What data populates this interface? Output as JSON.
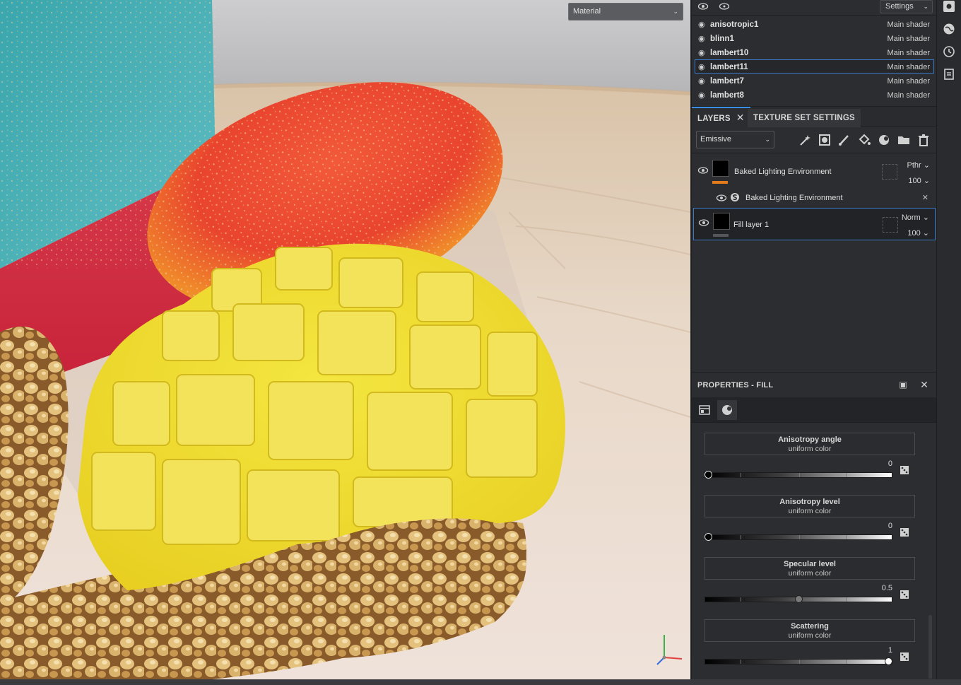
{
  "viewport": {
    "mode_select": "Material"
  },
  "texture_sets": {
    "settings_label": "Settings",
    "rows": [
      {
        "name": "anisotropic1",
        "shader": "Main shader"
      },
      {
        "name": "blinn1",
        "shader": "Main shader"
      },
      {
        "name": "lambert10",
        "shader": "Main shader"
      },
      {
        "name": "lambert11",
        "shader": "Main shader"
      },
      {
        "name": "lambert7",
        "shader": "Main shader"
      },
      {
        "name": "lambert8",
        "shader": "Main shader"
      }
    ],
    "selected": "lambert11"
  },
  "tabs": {
    "layers": "LAYERS",
    "texture_set_settings": "TEXTURE SET SETTINGS"
  },
  "layers_panel": {
    "channel": "Emissive",
    "layers": [
      {
        "name": "Baked Lighting Environment",
        "blend": "Pthr",
        "opacity": "100",
        "thumb_color": "#e07a1c"
      },
      {
        "name": "Baked Lighting Environment",
        "is_effect": true
      },
      {
        "name": "Fill layer 1",
        "blend": "Norm",
        "opacity": "100",
        "thumb_color": "#55565a"
      }
    ]
  },
  "properties": {
    "title": "PROPERTIES - FILL",
    "params": [
      {
        "name": "Anisotropy angle",
        "source": "uniform color",
        "value": "0",
        "fraction": 0
      },
      {
        "name": "Anisotropy level",
        "source": "uniform color",
        "value": "0",
        "fraction": 0
      },
      {
        "name": "Specular level",
        "source": "uniform color",
        "value": "0.5",
        "fraction": 0.5
      },
      {
        "name": "Scattering",
        "source": "uniform color",
        "value": "1",
        "fraction": 1
      }
    ]
  },
  "colors": {
    "accent_blue": "#3a8ee6",
    "selection_border": "#3a78c8",
    "panel_bg": "#2c2d30"
  }
}
